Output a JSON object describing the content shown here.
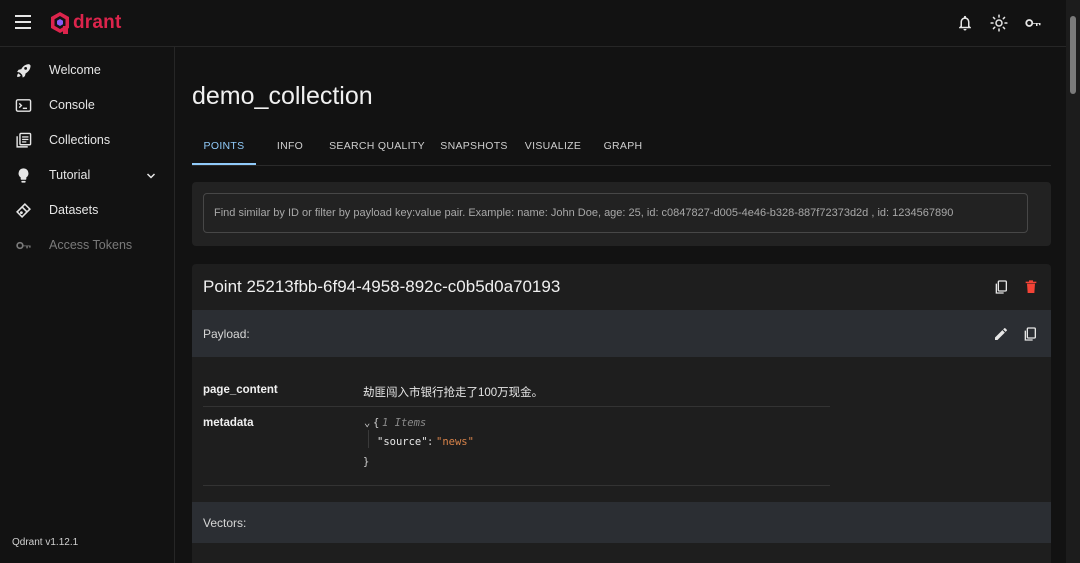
{
  "app": {
    "brand": "drant",
    "version": "Qdrant v1.12.1"
  },
  "topbar": {
    "icons": [
      "menu-icon",
      "bell-icon",
      "sun-icon",
      "key-icon"
    ]
  },
  "sidebar": {
    "items": [
      {
        "label": "Welcome",
        "icon": "rocket-icon"
      },
      {
        "label": "Console",
        "icon": "terminal-icon"
      },
      {
        "label": "Collections",
        "icon": "collections-icon"
      },
      {
        "label": "Tutorial",
        "icon": "lightbulb-icon"
      },
      {
        "label": "Datasets",
        "icon": "datasets-icon"
      },
      {
        "label": "Access Tokens",
        "icon": "key-icon"
      }
    ]
  },
  "main": {
    "title": "demo_collection",
    "tabs": [
      "POINTS",
      "INFO",
      "SEARCH QUALITY",
      "SNAPSHOTS",
      "VISUALIZE",
      "GRAPH"
    ],
    "active_tab": "POINTS",
    "search": {
      "placeholder": "Find similar by ID or filter by payload key:value pair. Example: name: John Doe, age: 25, id: c0847827-d005-4e46-b328-887f72373d2d , id: 1234567890"
    },
    "point": {
      "title": "Point 25213fbb-6f94-4958-892c-c0b5d0a70193",
      "payload_label": "Payload:",
      "fields": [
        {
          "key": "page_content",
          "value": "劫匪闯入市银行抢走了100万现金。"
        },
        {
          "key": "metadata"
        }
      ],
      "metadata_json": {
        "open": "{",
        "count": "1 Items",
        "entry_key": "\"source\"",
        "colon": ":",
        "entry_value": "\"news\"",
        "close": "}"
      },
      "vectors_label": "Vectors:"
    }
  },
  "colors": {
    "accent": "#90caf9",
    "brand": "#dc244c",
    "danger": "#f44336",
    "json_string": "#d9844a"
  }
}
